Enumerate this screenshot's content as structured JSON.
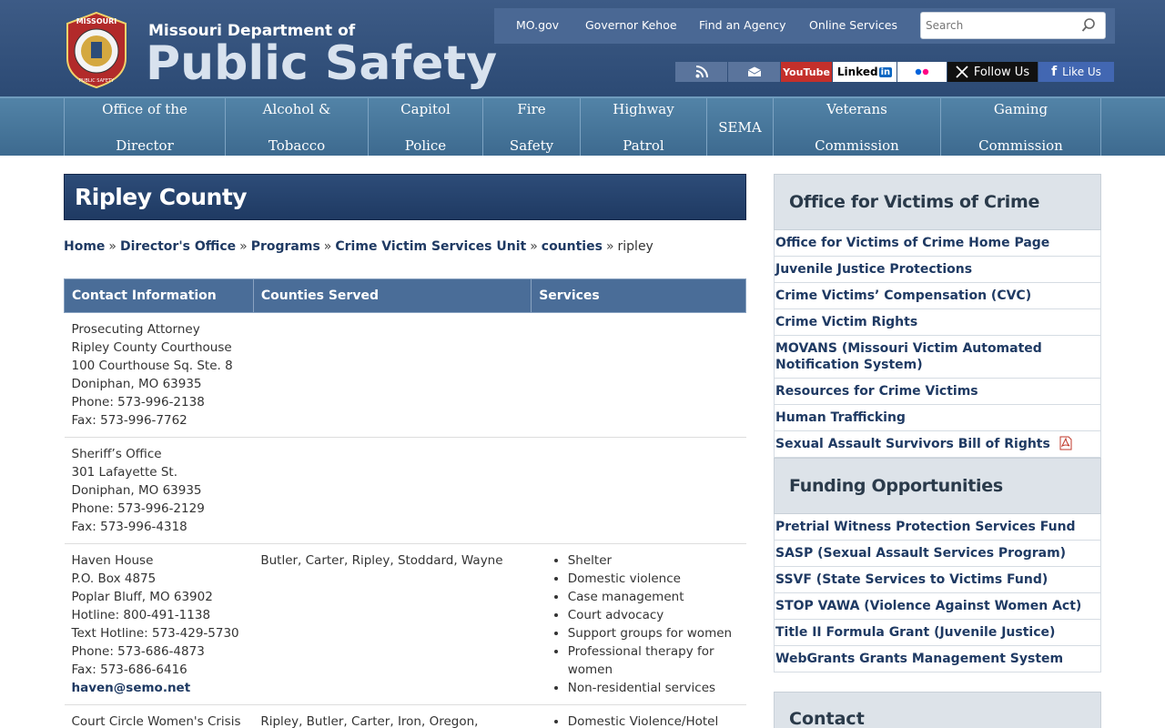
{
  "header": {
    "brand_small": "Missouri Department of",
    "brand_big": "Public Safety",
    "seal_text_top": "MISSOURI",
    "seal_text_bottom": "PUBLIC SAFETY",
    "topnav": [
      "MO.gov",
      "Governor Kehoe",
      "Find an Agency",
      "Online Services"
    ],
    "search_placeholder": "Search",
    "social": {
      "youtube": "YouTube",
      "linkedin": "Linked",
      "linkedin_in": "in",
      "x": "Follow Us",
      "facebook": "Like Us"
    }
  },
  "mainnav": [
    {
      "line1": "Office of the",
      "line2": "Director"
    },
    {
      "line1": "Alcohol &",
      "line2": "Tobacco"
    },
    {
      "line1": "Capitol",
      "line2": "Police"
    },
    {
      "line1": "Fire",
      "line2": "Safety"
    },
    {
      "line1": "Highway",
      "line2": "Patrol"
    },
    {
      "line1": "SEMA",
      "line2": ""
    },
    {
      "line1": "Veterans",
      "line2": "Commission"
    },
    {
      "line1": "Gaming",
      "line2": "Commission"
    }
  ],
  "page_title": "Ripley County",
  "breadcrumb": [
    "Home",
    "Director's Office",
    "Programs",
    "Crime Victim Services Unit",
    "counties"
  ],
  "breadcrumb_current": "ripley",
  "breadcrumb_sep": "»",
  "table": {
    "headers": [
      "Contact Information",
      "Counties Served",
      "Services"
    ],
    "rows": [
      {
        "contact": [
          "Prosecuting Attorney",
          "Ripley County Courthouse",
          "100 Courthouse Sq. Ste. 8",
          "Doniphan, MO 63935",
          "Phone: 573-996-2138",
          "Fax: 573-996-7762"
        ],
        "counties": "",
        "services": []
      },
      {
        "contact": [
          "Sheriff’s Office",
          "301 Lafayette St.",
          "Doniphan, MO 63935",
          "Phone: 573-996-2129",
          "Fax: 573-996-4318"
        ],
        "counties": "",
        "services": []
      },
      {
        "contact": [
          "Haven House",
          "P.O. Box 4875",
          "Poplar Bluff, MO 63902",
          "Hotline: 800-491-1138",
          "Text Hotline: 573-429-5730",
          "Phone: 573-686-4873",
          "Fax: 573-686-6416"
        ],
        "email": "haven@semo.net",
        "counties": "Butler, Carter, Ripley, Stoddard, Wayne",
        "services": [
          "Shelter",
          "Domestic violence",
          "Case management",
          "Court advocacy",
          "Support groups for women",
          "Professional therapy for women",
          "Non-residential services"
        ]
      },
      {
        "contact": [
          "Court Circle Women's Crisis"
        ],
        "counties": "Ripley, Butler, Carter, Iron, Oregon, Reynolds",
        "services": [
          "Domestic Violence/Hotel"
        ]
      }
    ]
  },
  "sidebar": {
    "section1_title": "Office for Victims of Crime",
    "section1_links": [
      "Office for Victims of Crime Home Page",
      "Juvenile Justice Protections",
      "Crime Victims’ Compensation (CVC)",
      "Crime Victim Rights",
      "MOVANS (Missouri Victim Automated Notification System)",
      "Resources for Crime Victims",
      "Human Trafficking",
      "Sexual Assault Survivors Bill of Rights"
    ],
    "section2_title": "Funding Opportunities",
    "section2_links": [
      "Pretrial Witness Protection Services Fund",
      "SASP (Sexual Assault Services Program)",
      "SSVF (State Services to Victims Fund)",
      "STOP VAWA (Violence Against Women Act)",
      "Title II Formula Grant (Juvenile Justice)",
      "WebGrants Grants Management System"
    ],
    "contact_title": "Contact"
  }
}
